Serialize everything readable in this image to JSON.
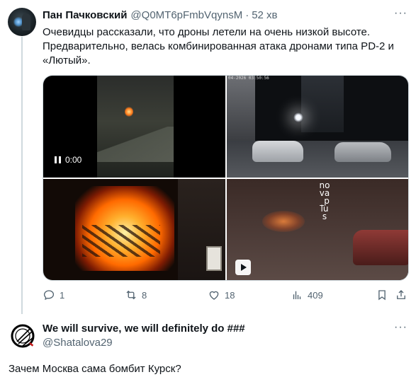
{
  "tweet": {
    "author_name": "Пан Пачковский",
    "author_handle": "@Q0MT6pFmbVqynsM",
    "separator": "·",
    "time": "52 хв",
    "more": "···",
    "text": "Очевидцы рассказали, что дроны летели на очень низкой высоте. Предварительно, велась комбинированная атака дронами типа PD-2 и «Лютый».",
    "media": {
      "video1_time": "0:00",
      "video2_timestamp": "04-2026 03:50:56",
      "video4_watermark": "nova_plus"
    },
    "actions": {
      "replies": "1",
      "retweets": "8",
      "likes": "18",
      "views": "409"
    }
  },
  "reply": {
    "author_name": "We will survive, we will definitely do ###",
    "author_handle": "@Shatalova29",
    "more": "···",
    "text": "Зачем Москва сама бомбит Курск?"
  }
}
